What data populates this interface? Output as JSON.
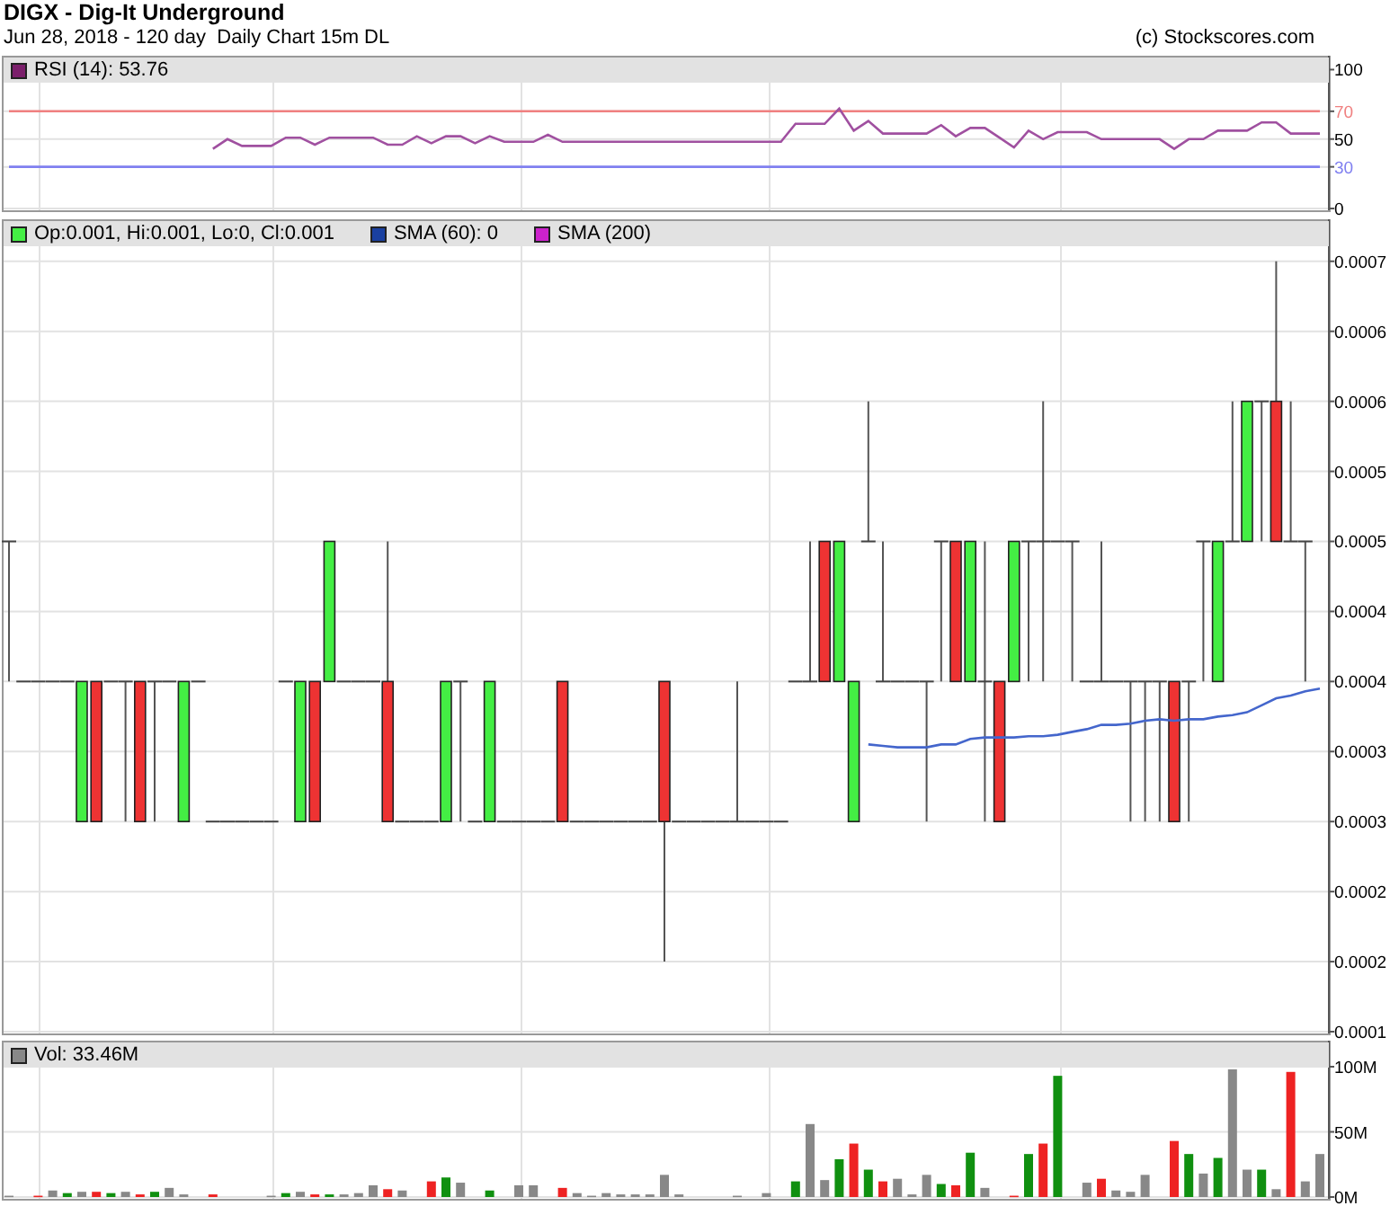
{
  "header": {
    "title": "DIGX - Dig-It Underground",
    "subtitle": "Jun 28, 2018 - 120 day  Daily Chart 15m DL",
    "credit": "(c) Stockscores.com"
  },
  "rsi_panel": {
    "legend": [
      {
        "label": "RSI (14): 53.76",
        "color": "#7b1f6b"
      }
    ],
    "chart_data": {
      "type": "line",
      "ylim": [
        0,
        110
      ],
      "yticks": [
        0,
        30,
        50,
        70,
        100
      ],
      "series": [
        {
          "color": "#f08080",
          "values": [
            70,
            70,
            70,
            70,
            70,
            70,
            70,
            70,
            70,
            70,
            70,
            70,
            70,
            70,
            70,
            70,
            70,
            70,
            70,
            70,
            70,
            70,
            70,
            70,
            70,
            70,
            70,
            70,
            70,
            70,
            70,
            70,
            70,
            70,
            70,
            70,
            70,
            70,
            70,
            70,
            70,
            70,
            70,
            70,
            70,
            70,
            70,
            70,
            70,
            70,
            70,
            70,
            70,
            70,
            70,
            70,
            70,
            70,
            70,
            70,
            70,
            70,
            70,
            70,
            70,
            70,
            70,
            70,
            70,
            70,
            70,
            70,
            70,
            70,
            70,
            70,
            70,
            70,
            70,
            70,
            70,
            70,
            70,
            70,
            70,
            70,
            70,
            70,
            70,
            70,
            70
          ]
        },
        {
          "color": "#8080f0",
          "values": [
            30,
            30,
            30,
            30,
            30,
            30,
            30,
            30,
            30,
            30,
            30,
            30,
            30,
            30,
            30,
            30,
            30,
            30,
            30,
            30,
            30,
            30,
            30,
            30,
            30,
            30,
            30,
            30,
            30,
            30,
            30,
            30,
            30,
            30,
            30,
            30,
            30,
            30,
            30,
            30,
            30,
            30,
            30,
            30,
            30,
            30,
            30,
            30,
            30,
            30,
            30,
            30,
            30,
            30,
            30,
            30,
            30,
            30,
            30,
            30,
            30,
            30,
            30,
            30,
            30,
            30,
            30,
            30,
            30,
            30,
            30,
            30,
            30,
            30,
            30,
            30,
            30,
            30,
            30,
            30,
            30,
            30,
            30,
            30,
            30,
            30,
            30,
            30,
            30,
            30,
            30
          ]
        },
        {
          "color": "#a050a0",
          "values": [
            null,
            null,
            null,
            null,
            null,
            null,
            null,
            null,
            null,
            null,
            null,
            null,
            null,
            null,
            43,
            50,
            45,
            45,
            45,
            51,
            51,
            46,
            51,
            51,
            51,
            51,
            46,
            46,
            52,
            47,
            52,
            52,
            47,
            52,
            48,
            48,
            48,
            53,
            48,
            48,
            48,
            48,
            48,
            48,
            48,
            48,
            48,
            48,
            48,
            48,
            48,
            48,
            48,
            48,
            61,
            61,
            61,
            72,
            56,
            63,
            54,
            54,
            54,
            54,
            60,
            52,
            58,
            58,
            51,
            44,
            56,
            50,
            55,
            55,
            55,
            50,
            50,
            50,
            50,
            50,
            43,
            50,
            50,
            56,
            56,
            56,
            62,
            62,
            54,
            54,
            54
          ]
        }
      ],
      "grid": true
    }
  },
  "price_panel": {
    "legend": [
      {
        "label": "Op:0.001, Hi:0.001, Lo:0, Cl:0.001",
        "color": "#44ee44"
      },
      {
        "label": "SMA (60): 0",
        "color": "#1a40a0"
      },
      {
        "label": "SMA (200)",
        "color": "#cc22cc"
      }
    ],
    "chart_data": {
      "type": "candlestick",
      "grid": true,
      "ylim": [
        0.00015,
        0.00073
      ],
      "yticks": [
        {
          "value": 0.0007,
          "label": "0.0007"
        },
        {
          "value": 0.00065,
          "label": "0.0006"
        },
        {
          "value": 0.0006,
          "label": "0.0006"
        },
        {
          "value": 0.00055,
          "label": "0.0005"
        },
        {
          "value": 0.0005,
          "label": "0.0005"
        },
        {
          "value": 0.00045,
          "label": "0.0004"
        },
        {
          "value": 0.0004,
          "label": "0.0004"
        },
        {
          "value": 0.00035,
          "label": "0.0003"
        },
        {
          "value": 0.0003,
          "label": "0.0003"
        },
        {
          "value": 0.00025,
          "label": "0.0002"
        },
        {
          "value": 0.0002,
          "label": "0.0002"
        },
        {
          "value": 0.00015,
          "label": "0.0001"
        }
      ],
      "series": [
        {
          "ohlc": [
            [
              0.0005,
              0.0005,
              0.0004,
              0.0005
            ],
            [
              0.0004,
              0.0004,
              0.0004,
              0.0004
            ],
            [
              0.0004,
              0.0004,
              0.0004,
              0.0004
            ],
            [
              0.0004,
              0.0004,
              0.0004,
              0.0004
            ],
            [
              0.0004,
              0.0004,
              0.0004,
              0.0004
            ],
            [
              0.0003,
              0.0004,
              0.0003,
              0.0004
            ],
            [
              0.0004,
              0.0004,
              0.0003,
              0.0003
            ],
            [
              0.0004,
              0.0004,
              0.0004,
              0.0004
            ],
            [
              0.0004,
              0.0004,
              0.0003,
              0.0004
            ],
            [
              0.0004,
              0.0004,
              0.0003,
              0.0003
            ],
            [
              0.0004,
              0.0004,
              0.0003,
              0.0004
            ],
            [
              0.0004,
              0.0004,
              0.0004,
              0.0004
            ],
            [
              0.0003,
              0.0004,
              0.0003,
              0.0004
            ],
            [
              0.0004,
              0.0004,
              0.0004,
              0.0004
            ],
            [
              0.0003,
              0.0003,
              0.0003,
              0.0003
            ],
            [
              0.0003,
              0.0003,
              0.0003,
              0.0003
            ],
            [
              0.0003,
              0.0003,
              0.0003,
              0.0003
            ],
            [
              0.0003,
              0.0003,
              0.0003,
              0.0003
            ],
            [
              0.0003,
              0.0003,
              0.0003,
              0.0003
            ],
            [
              0.0004,
              0.0004,
              0.0004,
              0.0004
            ],
            [
              0.0003,
              0.0004,
              0.0003,
              0.0004
            ],
            [
              0.0004,
              0.0004,
              0.0003,
              0.0003
            ],
            [
              0.0004,
              0.0005,
              0.0004,
              0.0005
            ],
            [
              0.0004,
              0.0004,
              0.0004,
              0.0004
            ],
            [
              0.0004,
              0.0004,
              0.0004,
              0.0004
            ],
            [
              0.0004,
              0.0004,
              0.0004,
              0.0004
            ],
            [
              0.0004,
              0.0005,
              0.0003,
              0.0003
            ],
            [
              0.0003,
              0.0003,
              0.0003,
              0.0003
            ],
            [
              0.0003,
              0.0003,
              0.0003,
              0.0003
            ],
            [
              0.0003,
              0.0003,
              0.0003,
              0.0003
            ],
            [
              0.0003,
              0.0004,
              0.0003,
              0.0004
            ],
            [
              0.0004,
              0.0004,
              0.0003,
              0.0004
            ],
            [
              0.0003,
              0.0003,
              0.0003,
              0.0003
            ],
            [
              0.0003,
              0.0004,
              0.0003,
              0.0004
            ],
            [
              0.0003,
              0.0003,
              0.0003,
              0.0003
            ],
            [
              0.0003,
              0.0003,
              0.0003,
              0.0003
            ],
            [
              0.0003,
              0.0003,
              0.0003,
              0.0003
            ],
            [
              0.0003,
              0.0003,
              0.0003,
              0.0003
            ],
            [
              0.0004,
              0.0004,
              0.0003,
              0.0003
            ],
            [
              0.0003,
              0.0003,
              0.0003,
              0.0003
            ],
            [
              0.0003,
              0.0003,
              0.0003,
              0.0003
            ],
            [
              0.0003,
              0.0003,
              0.0003,
              0.0003
            ],
            [
              0.0003,
              0.0003,
              0.0003,
              0.0003
            ],
            [
              0.0003,
              0.0003,
              0.0003,
              0.0003
            ],
            [
              0.0003,
              0.0003,
              0.0003,
              0.0003
            ],
            [
              0.0004,
              0.0004,
              0.0002,
              0.0003
            ],
            [
              0.0003,
              0.0003,
              0.0003,
              0.0003
            ],
            [
              0.0003,
              0.0003,
              0.0003,
              0.0003
            ],
            [
              0.0003,
              0.0003,
              0.0003,
              0.0003
            ],
            [
              0.0003,
              0.0003,
              0.0003,
              0.0003
            ],
            [
              0.0003,
              0.0004,
              0.0003,
              0.0003
            ],
            [
              0.0003,
              0.0003,
              0.0003,
              0.0003
            ],
            [
              0.0003,
              0.0003,
              0.0003,
              0.0003
            ],
            [
              0.0003,
              0.0003,
              0.0003,
              0.0003
            ],
            [
              0.0004,
              0.0004,
              0.0004,
              0.0004
            ],
            [
              0.0004,
              0.0005,
              0.0004,
              0.0004
            ],
            [
              0.0005,
              0.0005,
              0.0004,
              0.0004
            ],
            [
              0.0004,
              0.0005,
              0.0004,
              0.0005
            ],
            [
              0.0003,
              0.0004,
              0.0003,
              0.0004
            ],
            [
              0.0005,
              0.0006,
              0.0005,
              0.0005
            ],
            [
              0.0004,
              0.0005,
              0.0004,
              0.0004
            ],
            [
              0.0004,
              0.0004,
              0.0004,
              0.0004
            ],
            [
              0.0004,
              0.0004,
              0.0004,
              0.0004
            ],
            [
              0.0004,
              0.0004,
              0.0003,
              0.0004
            ],
            [
              0.0005,
              0.0005,
              0.0004,
              0.0005
            ],
            [
              0.0005,
              0.0005,
              0.0004,
              0.0004
            ],
            [
              0.0004,
              0.0005,
              0.0004,
              0.0005
            ],
            [
              0.0004,
              0.0005,
              0.0003,
              0.0004
            ],
            [
              0.0004,
              0.0004,
              0.0003,
              0.0003
            ],
            [
              0.0004,
              0.0005,
              0.0004,
              0.0005
            ],
            [
              0.0005,
              0.0005,
              0.0004,
              0.0005
            ],
            [
              0.0005,
              0.0006,
              0.0004,
              0.0005
            ],
            [
              0.0005,
              0.0005,
              0.0005,
              0.0005
            ],
            [
              0.0005,
              0.0005,
              0.0004,
              0.0005
            ],
            [
              0.0004,
              0.0004,
              0.0004,
              0.0004
            ],
            [
              0.0004,
              0.0005,
              0.0004,
              0.0004
            ],
            [
              0.0004,
              0.0004,
              0.0004,
              0.0004
            ],
            [
              0.0004,
              0.0004,
              0.0003,
              0.0004
            ],
            [
              0.0004,
              0.0004,
              0.0003,
              0.0004
            ],
            [
              0.0004,
              0.0004,
              0.0003,
              0.0004
            ],
            [
              0.0004,
              0.0004,
              0.0003,
              0.0003
            ],
            [
              0.0004,
              0.0004,
              0.0003,
              0.0004
            ],
            [
              0.0005,
              0.0005,
              0.0004,
              0.0005
            ],
            [
              0.0004,
              0.0005,
              0.0004,
              0.0005
            ],
            [
              0.0005,
              0.0006,
              0.0005,
              0.0005
            ],
            [
              0.0005,
              0.0006,
              0.0005,
              0.0006
            ],
            [
              0.0006,
              0.0006,
              0.0005,
              0.0006
            ],
            [
              0.0006,
              0.0007,
              0.0005,
              0.0005
            ],
            [
              0.0005,
              0.0006,
              0.0005,
              0.0005
            ],
            [
              0.0005,
              0.0005,
              0.0004,
              0.0005
            ],
            null
          ]
        },
        {
          "type": "line",
          "color": "#4466cc",
          "values": [
            null,
            null,
            null,
            null,
            null,
            null,
            null,
            null,
            null,
            null,
            null,
            null,
            null,
            null,
            null,
            null,
            null,
            null,
            null,
            null,
            null,
            null,
            null,
            null,
            null,
            null,
            null,
            null,
            null,
            null,
            null,
            null,
            null,
            null,
            null,
            null,
            null,
            null,
            null,
            null,
            null,
            null,
            null,
            null,
            null,
            null,
            null,
            null,
            null,
            null,
            null,
            null,
            null,
            null,
            null,
            null,
            null,
            null,
            null,
            0.000355,
            0.000354,
            0.000353,
            0.000353,
            0.000353,
            0.000355,
            0.000355,
            0.000359,
            0.00036,
            0.00036,
            0.00036,
            0.000361,
            0.000361,
            0.000362,
            0.000364,
            0.000366,
            0.000369,
            0.000369,
            0.00037,
            0.000372,
            0.000373,
            0.000372,
            0.000373,
            0.000373,
            0.000375,
            0.000376,
            0.000378,
            0.000383,
            0.000388,
            0.00039,
            0.000393,
            0.000395
          ]
        }
      ]
    }
  },
  "volume_panel": {
    "legend": [
      {
        "label": "Vol: 33.46M",
        "color": "#888888"
      }
    ],
    "chart_data": {
      "type": "bar",
      "grid": true,
      "ylim": [
        0,
        120
      ],
      "yticks": [
        {
          "value": 0,
          "label": "0M"
        },
        {
          "value": 50,
          "label": "50M"
        },
        {
          "value": 100,
          "label": "100M"
        }
      ],
      "series": [
        {
          "color": "#888888",
          "values": [
            1,
            null,
            null,
            5,
            null,
            4,
            null,
            null,
            4,
            null,
            null,
            7,
            2,
            null,
            null,
            null,
            null,
            null,
            1,
            null,
            4,
            null,
            null,
            2,
            3,
            9,
            null,
            5,
            null,
            null,
            null,
            11,
            null,
            null,
            null,
            9,
            9,
            null,
            null,
            3,
            1,
            3,
            2,
            2,
            2,
            17,
            2,
            null,
            null,
            null,
            1,
            null,
            3,
            null,
            null,
            56,
            13,
            null,
            null,
            null,
            null,
            14,
            2,
            17,
            null,
            null,
            null,
            7,
            null,
            null,
            null,
            null,
            null,
            null,
            11,
            null,
            5,
            4,
            17,
            null,
            null,
            null,
            18,
            null,
            98,
            21,
            null,
            6,
            null,
            12,
            33
          ]
        },
        {
          "color": "#109010",
          "values": [
            null,
            null,
            null,
            null,
            3,
            null,
            null,
            3,
            null,
            null,
            4,
            null,
            null,
            null,
            null,
            null,
            null,
            null,
            null,
            3,
            null,
            null,
            2,
            null,
            null,
            null,
            null,
            null,
            null,
            null,
            15,
            null,
            null,
            5,
            null,
            null,
            null,
            null,
            null,
            null,
            null,
            null,
            null,
            null,
            null,
            null,
            null,
            null,
            null,
            null,
            null,
            null,
            null,
            null,
            12,
            null,
            null,
            29,
            null,
            21,
            null,
            null,
            null,
            null,
            10,
            null,
            34,
            null,
            null,
            null,
            33,
            null,
            93,
            null,
            null,
            null,
            null,
            null,
            null,
            null,
            null,
            33,
            null,
            30,
            null,
            null,
            21,
            null,
            null,
            null,
            null
          ]
        },
        {
          "color": "#ee2222",
          "values": [
            null,
            null,
            1,
            null,
            null,
            null,
            4,
            null,
            null,
            2,
            null,
            null,
            null,
            null,
            2,
            null,
            null,
            null,
            null,
            null,
            null,
            2,
            null,
            null,
            null,
            null,
            6,
            null,
            null,
            12,
            null,
            null,
            null,
            null,
            null,
            null,
            null,
            null,
            7,
            null,
            null,
            null,
            null,
            null,
            null,
            null,
            null,
            null,
            null,
            null,
            null,
            null,
            null,
            null,
            null,
            null,
            null,
            null,
            41,
            null,
            12,
            null,
            null,
            null,
            null,
            9,
            null,
            null,
            null,
            1,
            null,
            41,
            null,
            null,
            null,
            14,
            null,
            null,
            null,
            null,
            43,
            null,
            null,
            null,
            null,
            null,
            null,
            null,
            96,
            null,
            null
          ]
        }
      ]
    }
  }
}
